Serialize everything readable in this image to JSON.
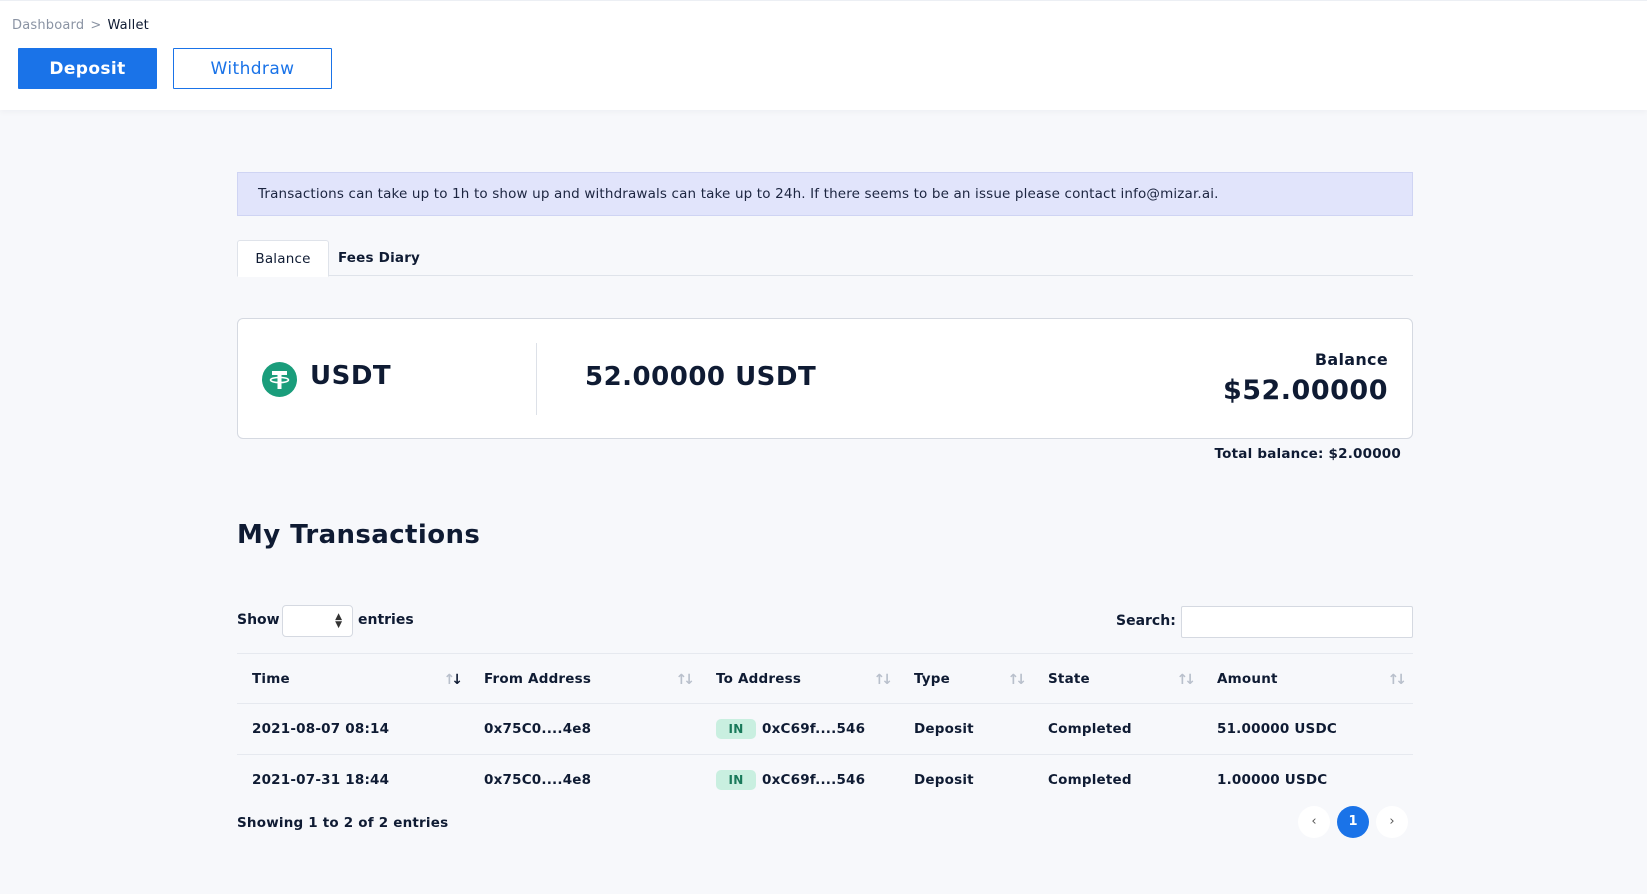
{
  "breadcrumb": {
    "parent": "Dashboard",
    "separator": ">",
    "current": "Wallet"
  },
  "actions": {
    "deposit": "Deposit",
    "withdraw": "Withdraw"
  },
  "notice": "Transactions can take up to 1h to show up and withdrawals can take up to 24h. If there seems to be an issue please contact info@mizar.ai.",
  "tabs": [
    {
      "label": "Balance",
      "active": true
    },
    {
      "label": "Fees Diary",
      "active": false
    }
  ],
  "balance_card": {
    "coin": "USDT",
    "coin_icon": "tether-icon",
    "amount": "52.00000 USDT",
    "balance_label": "Balance",
    "balance_value": "$52.00000"
  },
  "total_balance": "Total balance: $2.00000",
  "transactions": {
    "title": "My Transactions",
    "show_label": "Show",
    "entries_label": "entries",
    "entries_value": "",
    "search_label": "Search:",
    "search_value": "",
    "columns": [
      "Time",
      "From Address",
      "To Address",
      "Type",
      "State",
      "Amount"
    ],
    "rows": [
      {
        "time": "2021-08-07 08:14",
        "from": "0x75C0....4e8",
        "badge": "IN",
        "to": "0xC69f....546",
        "type": "Deposit",
        "state": "Completed",
        "amount": "51.00000 USDC"
      },
      {
        "time": "2021-07-31 18:44",
        "from": "0x75C0....4e8",
        "badge": "IN",
        "to": "0xC69f....546",
        "type": "Deposit",
        "state": "Completed",
        "amount": "1.00000 USDC"
      }
    ],
    "showing": "Showing 1 to 2 of 2 entries",
    "pagination": {
      "prev": "‹",
      "current": "1",
      "next": "›"
    }
  },
  "colors": {
    "primary": "#1a73e8",
    "tether": "#1a9d7b",
    "notice_bg": "#e1e4fb",
    "badge_bg": "#c9efe0"
  }
}
